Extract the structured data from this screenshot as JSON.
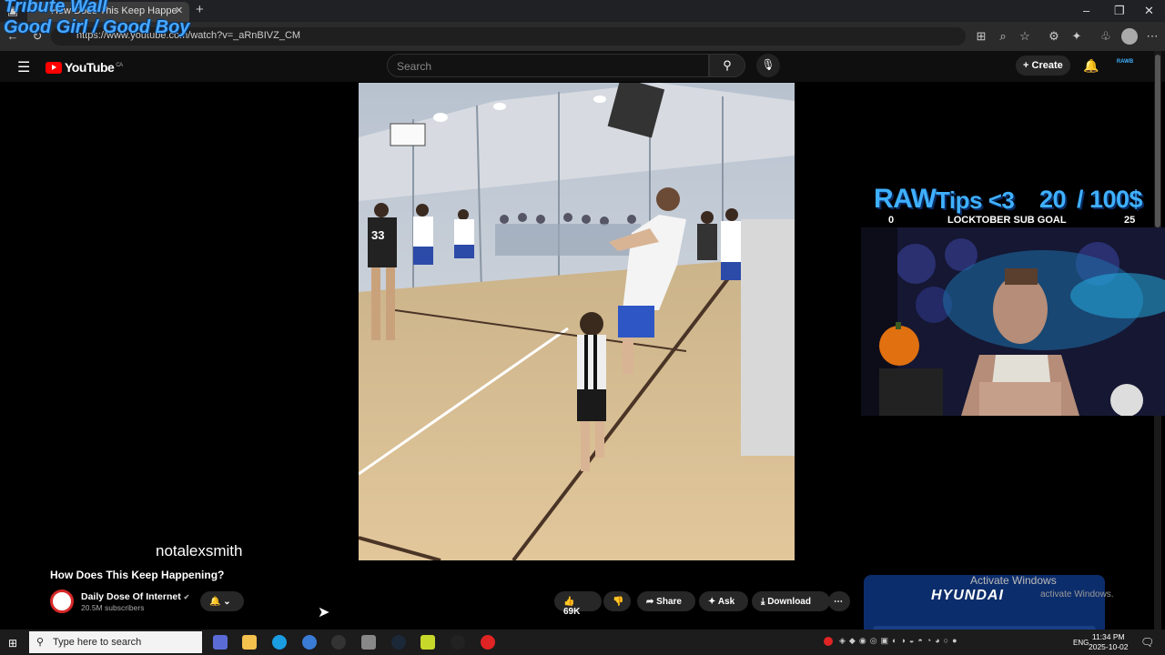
{
  "browser": {
    "tab_title": "How Does This Keep Happe",
    "url": "https://www.youtube.com/watch?v=_aRnBIVZ_CM",
    "new_tab_symbol": "+"
  },
  "overlay": {
    "line1": "Tribute Wall",
    "line2": "Good Girl / Good Boy"
  },
  "youtube": {
    "logo_text": "YouTube",
    "region": "CA",
    "search_placeholder": "Search",
    "create_label": "Create",
    "avatar_text": "RAWB"
  },
  "video": {
    "watermark": "notalexsmith",
    "title": "How Does This Keep Happening?",
    "channel_name": "Daily Dose Of Internet",
    "subscribers": "20.5M subscribers",
    "likes": "69K",
    "share_label": "Share",
    "ask_label": "Ask",
    "download_label": "Download",
    "jersey_number": "33"
  },
  "stream": {
    "brand": "RAW",
    "tips": "Tips <3",
    "goal_current": "20",
    "goal_target": "/ 100$",
    "goal_min": "0",
    "goal_label": "LOCKTOBER SUB GOAL",
    "goal_max": "25"
  },
  "ad": {
    "brand": "HYUNDAI"
  },
  "windows": {
    "activate_title": "Activate Windows",
    "activate_sub": "activate Windows.",
    "taskbar_search": "Type here to search",
    "language": "ENG",
    "time": "11:34 PM",
    "date": "2025-10-02"
  },
  "colors": {
    "youtube_red": "#ff0000",
    "overlay_blue": "#3fb0ff",
    "ad_blue": "#0c2d6b"
  }
}
